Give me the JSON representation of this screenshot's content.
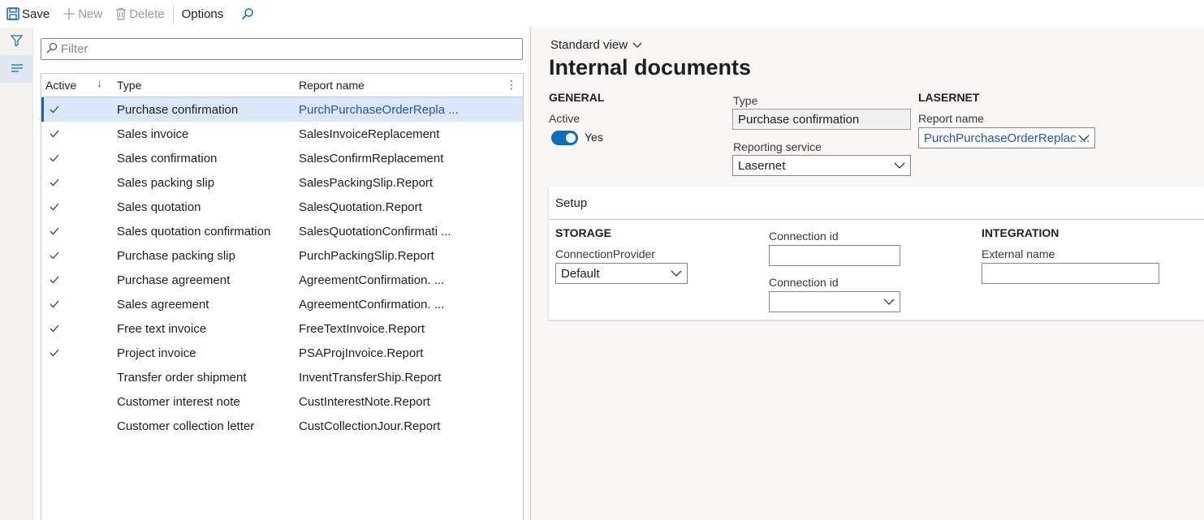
{
  "toolbar": {
    "save_label": "Save",
    "new_label": "New",
    "delete_label": "Delete",
    "options_label": "Options"
  },
  "filter": {
    "placeholder": "Filter"
  },
  "grid": {
    "columns": {
      "active": "Active",
      "type": "Type",
      "report": "Report name"
    },
    "rows": [
      {
        "active": true,
        "type": "Purchase confirmation",
        "report": "PurchPurchaseOrderRepla ...",
        "selected": true
      },
      {
        "active": true,
        "type": "Sales invoice",
        "report": "SalesInvoiceReplacement"
      },
      {
        "active": true,
        "type": "Sales confirmation",
        "report": "SalesConfirmReplacement"
      },
      {
        "active": true,
        "type": "Sales packing slip",
        "report": "SalesPackingSlip.Report"
      },
      {
        "active": true,
        "type": "Sales quotation",
        "report": "SalesQuotation.Report"
      },
      {
        "active": true,
        "type": "Sales quotation confirmation",
        "report": "SalesQuotationConfirmati ..."
      },
      {
        "active": true,
        "type": "Purchase packing slip",
        "report": "PurchPackingSlip.Report"
      },
      {
        "active": true,
        "type": "Purchase agreement",
        "report": "AgreementConfirmation. ..."
      },
      {
        "active": true,
        "type": "Sales agreement",
        "report": "AgreementConfirmation. ..."
      },
      {
        "active": true,
        "type": "Free text invoice",
        "report": "FreeTextInvoice.Report"
      },
      {
        "active": true,
        "type": "Project invoice",
        "report": "PSAProjInvoice.Report"
      },
      {
        "active": false,
        "type": "Transfer order shipment",
        "report": "InventTransferShip.Report"
      },
      {
        "active": false,
        "type": "Customer interest note",
        "report": "CustInterestNote.Report"
      },
      {
        "active": false,
        "type": "Customer collection letter",
        "report": "CustCollectionJour.Report"
      }
    ]
  },
  "details": {
    "view_label": "Standard view",
    "title": "Internal documents",
    "general": {
      "heading": "GENERAL",
      "active_label": "Active",
      "active_value": "Yes",
      "type_label": "Type",
      "type_value": "Purchase confirmation",
      "reporting_service_label": "Reporting service",
      "reporting_service_value": "Lasernet"
    },
    "lasernet": {
      "heading": "LASERNET",
      "report_name_label": "Report name",
      "report_name_value": "PurchPurchaseOrderReplac ..."
    },
    "setup": {
      "title": "Setup",
      "storage_heading": "STORAGE",
      "connection_provider_label": "ConnectionProvider",
      "connection_provider_value": "Default",
      "connection_id_label_1": "Connection id",
      "connection_id_value_1": "",
      "connection_id_label_2": "Connection id",
      "connection_id_value_2": "",
      "integration_heading": "INTEGRATION",
      "external_name_label": "External name",
      "external_name_value": ""
    }
  },
  "colors": {
    "accent": "#0f6cbd",
    "link": "#1f57b6",
    "selected_row": "#dbe6f6"
  }
}
